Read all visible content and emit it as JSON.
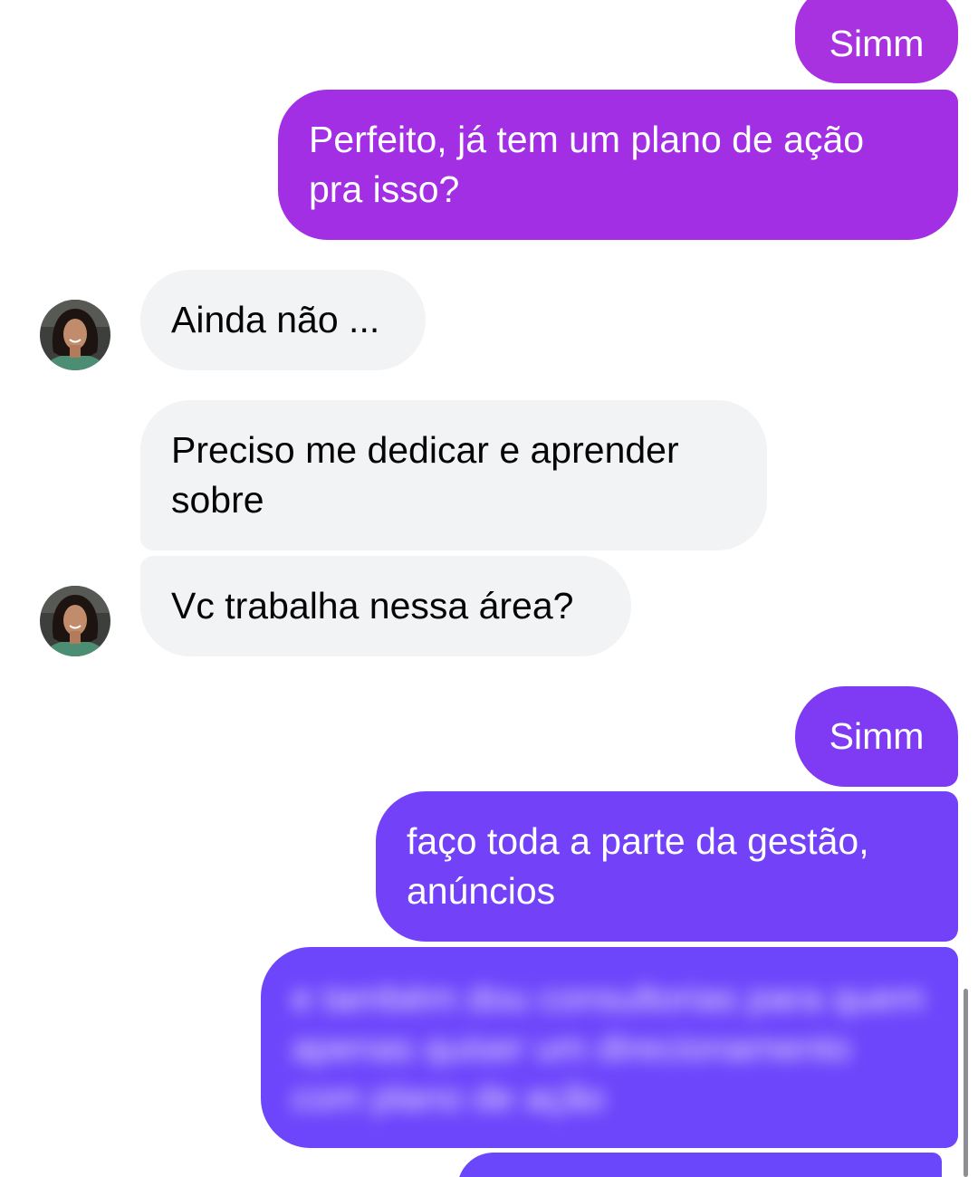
{
  "colors": {
    "outgoing_top": "#a932e0",
    "outgoing_mid": "#7d3cf5",
    "outgoing_bottom": "#6c45fb",
    "incoming": "#f2f3f5"
  },
  "messages": [
    {
      "id": "m1",
      "direction": "out",
      "text": "Simm"
    },
    {
      "id": "m2",
      "direction": "out",
      "text": "Perfeito, já tem um plano de ação pra isso?"
    },
    {
      "id": "m3",
      "direction": "in",
      "text": "Ainda não ..."
    },
    {
      "id": "m4",
      "direction": "in",
      "text": "Preciso me dedicar e aprender sobre"
    },
    {
      "id": "m5",
      "direction": "in",
      "text": "Vc trabalha nessa área?"
    },
    {
      "id": "m6",
      "direction": "out",
      "text": "Simm"
    },
    {
      "id": "m7",
      "direction": "out",
      "text": "faço toda a parte da gestão, anúncios"
    },
    {
      "id": "m8",
      "direction": "out",
      "text": "e também dou consultorias para quem apenas quiser um direcionamento com plano de ação",
      "blurred": true
    }
  ],
  "avatar": {
    "icon": "profile-photo-avatar"
  }
}
